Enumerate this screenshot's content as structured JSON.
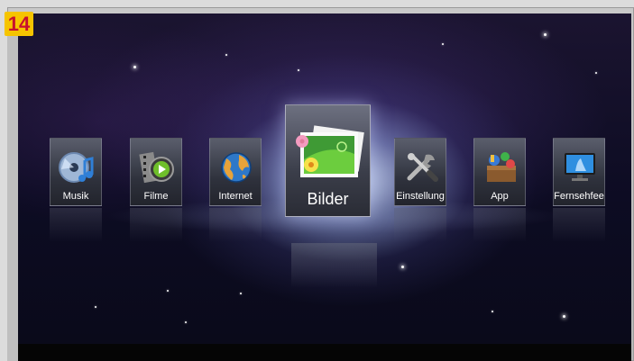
{
  "badge": "14",
  "menu": {
    "items": [
      {
        "label": "Musik",
        "icon": "music-disc-icon"
      },
      {
        "label": "Filme",
        "icon": "film-reel-icon"
      },
      {
        "label": "Internet",
        "icon": "globe-icon"
      },
      {
        "label": "Bilder",
        "icon": "photo-icon",
        "selected": true
      },
      {
        "label": "Einstellung",
        "icon": "tools-icon"
      },
      {
        "label": "App",
        "icon": "app-box-icon"
      },
      {
        "label": "Fernsehfee",
        "icon": "tv-icon"
      }
    ]
  },
  "colors": {
    "badge_bg": "#f6c400",
    "badge_text": "#c8102e",
    "screen_bg": "#0d0c23"
  }
}
